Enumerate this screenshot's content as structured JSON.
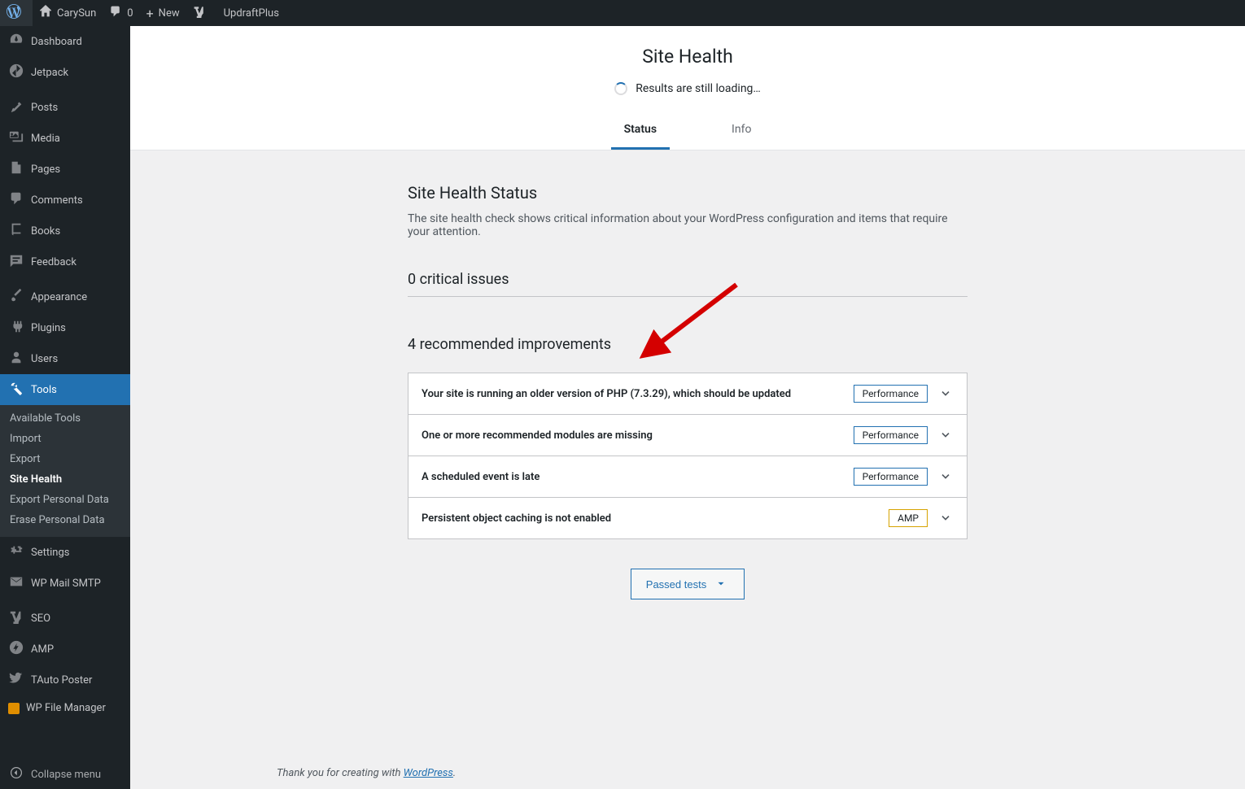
{
  "toolbar": {
    "site_name": "CarySun",
    "comments_count": "0",
    "new_label": "New",
    "updraft_label": "UpdraftPlus"
  },
  "sidebar": {
    "items": [
      {
        "label": "Dashboard",
        "icon": "dashboard"
      },
      {
        "label": "Jetpack",
        "icon": "jetpack"
      },
      {
        "separator": true
      },
      {
        "label": "Posts",
        "icon": "pin"
      },
      {
        "label": "Media",
        "icon": "media"
      },
      {
        "label": "Pages",
        "icon": "page"
      },
      {
        "label": "Comments",
        "icon": "comment"
      },
      {
        "label": "Books",
        "icon": "book"
      },
      {
        "label": "Feedback",
        "icon": "feedback"
      },
      {
        "separator": true
      },
      {
        "label": "Appearance",
        "icon": "brush"
      },
      {
        "label": "Plugins",
        "icon": "plugin"
      },
      {
        "label": "Users",
        "icon": "users"
      },
      {
        "label": "Tools",
        "icon": "tools",
        "current": true
      },
      {
        "label": "Settings",
        "icon": "settings"
      },
      {
        "label": "WP Mail SMTP",
        "icon": "mail"
      },
      {
        "separator": true
      },
      {
        "label": "SEO",
        "icon": "seo"
      },
      {
        "label": "AMP",
        "icon": "amp"
      },
      {
        "label": "TAuto Poster",
        "icon": "twitter"
      },
      {
        "label": "WP File Manager",
        "icon": "filemanager"
      }
    ],
    "submenu": [
      {
        "label": "Available Tools"
      },
      {
        "label": "Import"
      },
      {
        "label": "Export"
      },
      {
        "label": "Site Health",
        "current": true
      },
      {
        "label": "Export Personal Data"
      },
      {
        "label": "Erase Personal Data"
      }
    ],
    "collapse_label": "Collapse menu"
  },
  "header": {
    "title": "Site Health",
    "loading_text": "Results are still loading…",
    "tab_status": "Status",
    "tab_info": "Info"
  },
  "body": {
    "status_heading": "Site Health Status",
    "status_desc": "The site health check shows critical information about your WordPress configuration and items that require your attention.",
    "critical_heading": "0 critical issues",
    "recommended_heading": "4 recommended improvements",
    "issues": [
      {
        "title": "Your site is running an older version of PHP (7.3.29), which should be updated",
        "badge": "Performance",
        "badge_class": "performance"
      },
      {
        "title": "One or more recommended modules are missing",
        "badge": "Performance",
        "badge_class": "performance"
      },
      {
        "title": "A scheduled event is late",
        "badge": "Performance",
        "badge_class": "performance"
      },
      {
        "title": "Persistent object caching is not enabled",
        "badge": "AMP",
        "badge_class": "amp"
      }
    ],
    "passed_label": "Passed tests"
  },
  "footer": {
    "text": "Thank you for creating with ",
    "link": "WordPress",
    "suffix": "."
  }
}
